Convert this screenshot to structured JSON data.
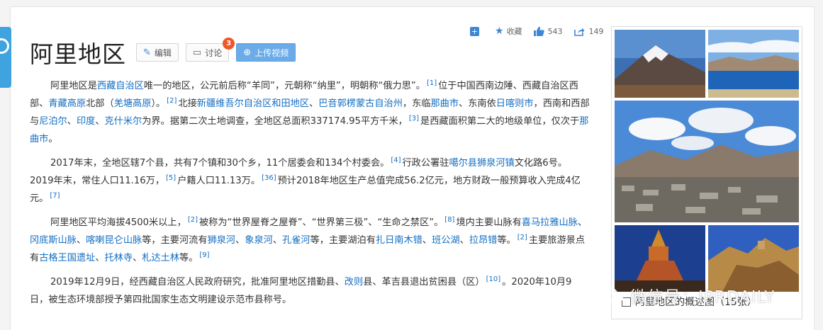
{
  "header": {
    "title": "阿里地区",
    "edit_label": "编辑",
    "discuss_label": "讨论",
    "discuss_count": "3",
    "upload_label": "上传视频"
  },
  "toolbar": {
    "collect_label": "收藏",
    "like_count": "543",
    "share_count": "149"
  },
  "paragraphs": {
    "p1": [
      {
        "t": "阿里地区是"
      },
      {
        "t": "西藏自治区",
        "link": true
      },
      {
        "t": "唯一的地区，公元前后称“羊同”，元朝称“纳里”，明朝称“俄力思”。"
      },
      {
        "t": "[1]",
        "ref": true
      },
      {
        "t": "位于中国西南边陲、西藏自治区西部、"
      },
      {
        "t": "青藏高原",
        "link": true
      },
      {
        "t": "北部（"
      },
      {
        "t": "羌塘高原",
        "link": true
      },
      {
        "t": "）。"
      },
      {
        "t": "[2]",
        "ref": true
      },
      {
        "t": "北接"
      },
      {
        "t": "新疆维吾尔自治区",
        "link": true
      },
      {
        "t": "和田地区",
        "link": true
      },
      {
        "t": "、"
      },
      {
        "t": "巴音郭楞蒙古自治州",
        "link": true
      },
      {
        "t": "，东临"
      },
      {
        "t": "那曲市",
        "link": true
      },
      {
        "t": "、东南依"
      },
      {
        "t": "日喀则市",
        "link": true
      },
      {
        "t": "，西南和西部与"
      },
      {
        "t": "尼泊尔",
        "link": true
      },
      {
        "t": "、"
      },
      {
        "t": "印度",
        "link": true
      },
      {
        "t": "、"
      },
      {
        "t": "克什米尔",
        "link": true
      },
      {
        "t": "为界。据第二次土地调查，全地区总面积337174.95平方千米，"
      },
      {
        "t": "[3]",
        "ref": true
      },
      {
        "t": "是西藏面积第二大的地级单位，仅次于"
      },
      {
        "t": "那曲市",
        "link": true
      },
      {
        "t": "。"
      }
    ],
    "p2": [
      {
        "t": "2017年末，全地区辖7个县，共有7个镇和30个乡，11个居委会和134个村委会。"
      },
      {
        "t": "[4]",
        "ref": true
      },
      {
        "t": "行政公署驻"
      },
      {
        "t": "噶尔县",
        "link": true
      },
      {
        "t": "狮泉河镇",
        "link": true
      },
      {
        "t": "文化路6号。2019年末，常住人口11.16万，"
      },
      {
        "t": "[5]",
        "ref": true
      },
      {
        "t": "户籍人口11.13万。"
      },
      {
        "t": "[36]",
        "ref": true
      },
      {
        "t": "预计2018年地区生产总值完成56.2亿元，地方财政一般预算收入完成4亿元。"
      },
      {
        "t": "[7]",
        "ref": true
      }
    ],
    "p3": [
      {
        "t": "阿里地区平均海拔4500米以上，"
      },
      {
        "t": "[2]",
        "ref": true
      },
      {
        "t": "被称为“世界屋脊之屋脊”、“世界第三极”、“生命之禁区”。"
      },
      {
        "t": "[8]",
        "ref": true
      },
      {
        "t": "境内主要山脉有"
      },
      {
        "t": "喜马拉雅山脉",
        "link": true
      },
      {
        "t": "、"
      },
      {
        "t": "冈底斯山脉",
        "link": true
      },
      {
        "t": "、"
      },
      {
        "t": "喀喇昆仑山脉",
        "link": true
      },
      {
        "t": "等，主要河流有"
      },
      {
        "t": "狮泉河",
        "link": true
      },
      {
        "t": "、"
      },
      {
        "t": "象泉河",
        "link": true
      },
      {
        "t": "、"
      },
      {
        "t": "孔雀河",
        "link": true
      },
      {
        "t": "等，主要湖泊有"
      },
      {
        "t": "扎日南木错",
        "link": true
      },
      {
        "t": "、"
      },
      {
        "t": "班公湖",
        "link": true
      },
      {
        "t": "、"
      },
      {
        "t": "拉昂错",
        "link": true
      },
      {
        "t": "等。"
      },
      {
        "t": "[2]",
        "ref": true
      },
      {
        "t": "主要旅游景点有"
      },
      {
        "t": "古格王国遗址",
        "link": true
      },
      {
        "t": "、"
      },
      {
        "t": "托林寺",
        "link": true
      },
      {
        "t": "、"
      },
      {
        "t": "札达土林",
        "link": true
      },
      {
        "t": "等。"
      },
      {
        "t": "[9]",
        "ref": true
      }
    ],
    "p4": [
      {
        "t": "2019年12月9日，经西藏自治区人民政府研究，批准阿里地区措勤县、"
      },
      {
        "t": "改则",
        "link": true
      },
      {
        "t": "县、革吉县退出贫困县（区）"
      },
      {
        "t": "[10]",
        "ref": true
      },
      {
        "t": "。2020年10月9日，被生态环境部授予第四批国家生态文明建设示范市县称号。"
      }
    ]
  },
  "album": {
    "caption": "阿里地区的概述图（15张）"
  },
  "watermark": {
    "text": "微信号：IPRDAILY"
  },
  "colors": {
    "link": "#136ec2",
    "accent": "#3e86d6",
    "badge": "#f0562a"
  }
}
